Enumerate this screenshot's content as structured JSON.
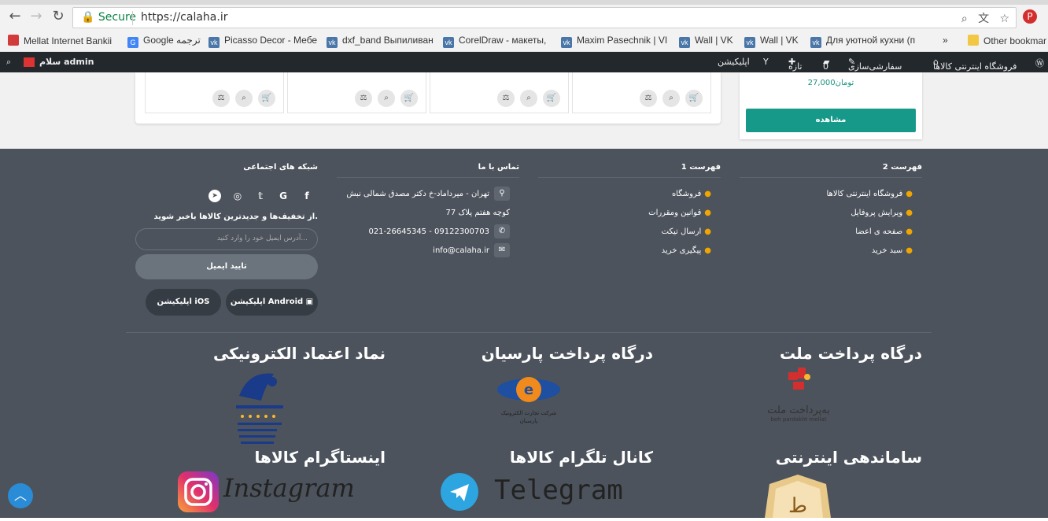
{
  "browser": {
    "secure_label": "Secure",
    "url": "https://calaha.ir"
  },
  "bookmarks": [
    {
      "label": "Mellat Internet Bankii"
    },
    {
      "label": "Google ترجمه"
    },
    {
      "label": "Picasso Decor - Мебе"
    },
    {
      "label": "dxf_band Выпиливан"
    },
    {
      "label": "CorelDraw - макеты,"
    },
    {
      "label": "Maxim Pasechnik | VI"
    },
    {
      "label": "Wall | VK"
    },
    {
      "label": "Wall | VK"
    },
    {
      "label": "Для уютной кухни (п"
    },
    {
      "label": "»"
    },
    {
      "label": "Other bookmar"
    }
  ],
  "adminbar": {
    "greeting": "سلام admin",
    "site_name": "فروشگاه اینترنتی کالاها",
    "customize": "سفارشی‌سازی",
    "new": "تازه",
    "comments_count": "0",
    "app": "اپلیکیشن"
  },
  "sidecard": {
    "price": "27,000تومان",
    "view_button": "مشاهده"
  },
  "footer": {
    "menu2": {
      "title": "فهرست 2",
      "items": [
        "فروشگاه اینترنتی کالاها",
        "ویرایش پروفایل",
        "صفحه ی اعضا",
        "سبد خرید"
      ]
    },
    "menu1": {
      "title": "فهرست 1",
      "items": [
        "فروشگاه",
        "قوانین ومقررات",
        "ارسال تیکت",
        "پیگیری خرید"
      ]
    },
    "contact": {
      "title": "تماس با ما",
      "address_line1": "تهران - میرداماد-خ دکتر مصدق شمالی نبش",
      "address_line2": "کوچه هفتم پلاک 77",
      "phone": "021-26645345 - 09122300703",
      "email": "info@calaha.ir"
    },
    "social": {
      "title": "شبکه های اجتماعی",
      "newsletter_text": "از تخفیف‌ها و جدیدترین کالاها باخبر شوید.",
      "email_placeholder": "آدرس ایمیل خود را وارد کنید...",
      "email_button": "تایید ایمیل",
      "android_button": "اپلیکیشن Android",
      "ios_button": "اپلیکیشن iOS"
    },
    "badges": {
      "mellat_title": "درگاه پرداخت ملت",
      "mellat_logo": "به‌پرداخت ملت",
      "mellat_logo_en": "beh pardakht mellat",
      "parsian_title": "درگاه پرداخت پارسیان",
      "parsian_logo": "شرکت تجارت الکترونیک پارسیان",
      "enamad_title": "نماد اعتماد الکترونیکی",
      "samandehi_title": "ساماندهی اینترنتی",
      "telegram_title": "کانال تلگرام کالاها",
      "telegram_word": "Telegram",
      "instagram_title": "اینستاگرام کالاها",
      "instagram_word": "Instagram"
    }
  },
  "colors": {
    "footer_bg": "#4c535c",
    "accent": "#17998a",
    "bullet": "#f0a500",
    "adminbar": "#23282d"
  }
}
